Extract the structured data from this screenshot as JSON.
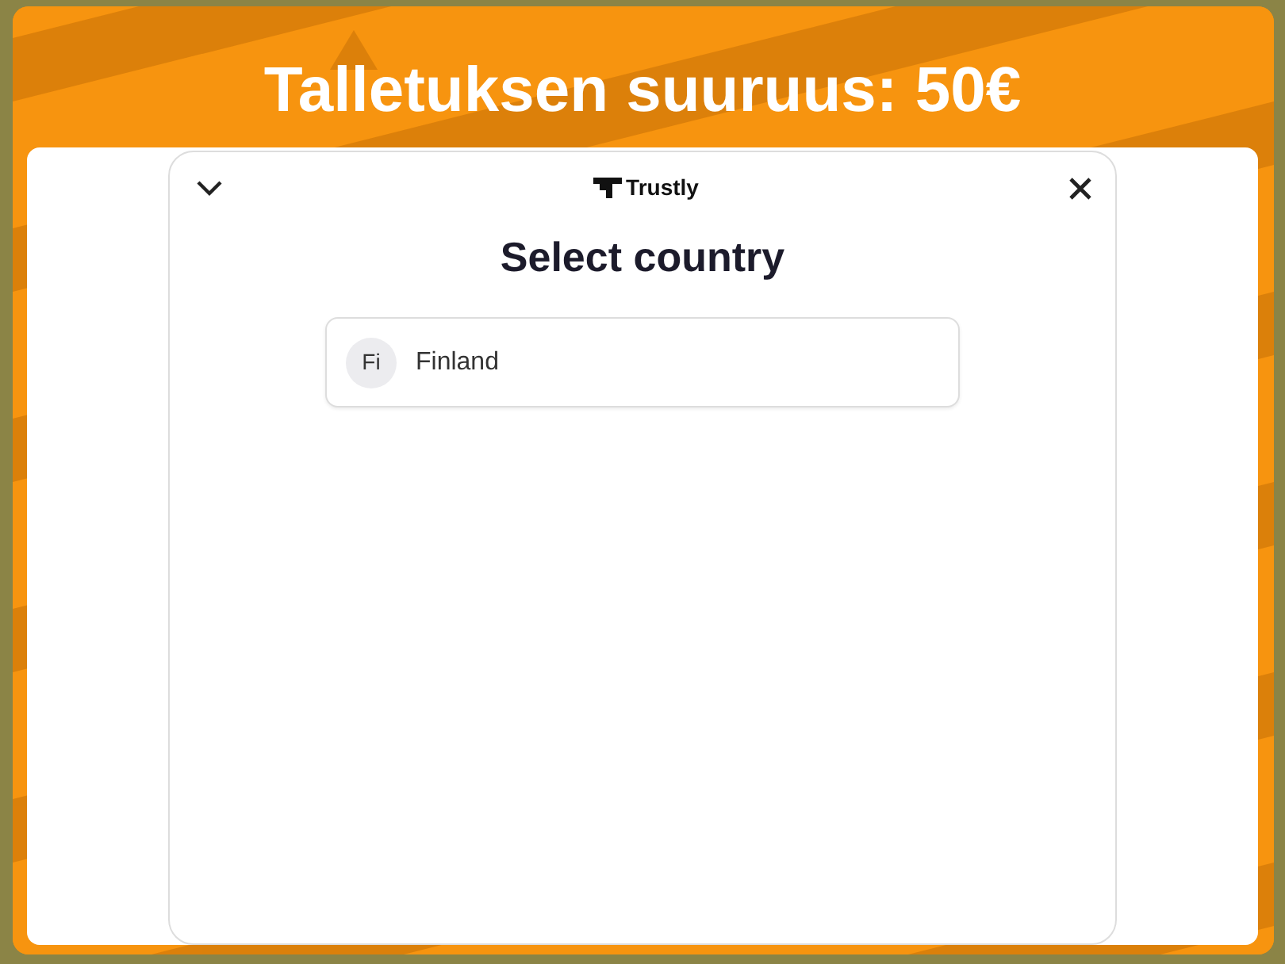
{
  "header": {
    "title": "Talletuksen suuruus: 50€"
  },
  "dialog": {
    "brand": "Trustly",
    "title": "Select country",
    "countries": [
      {
        "code": "Fi",
        "name": "Finland"
      }
    ]
  }
}
